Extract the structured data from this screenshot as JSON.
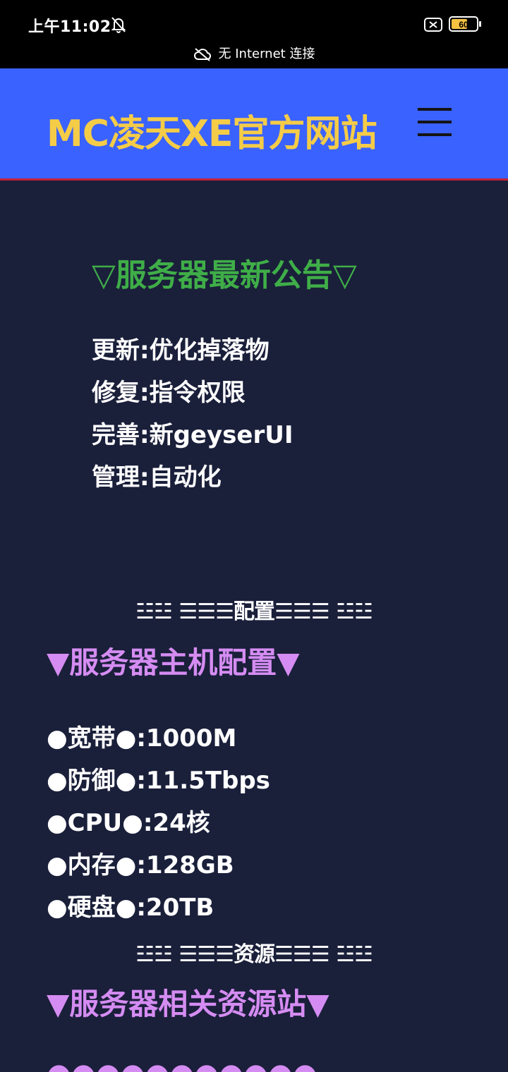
{
  "status_bar": {
    "time": "上午11:02",
    "network_text": "无 Internet 连接",
    "battery_level": "60"
  },
  "header": {
    "site_title": "MC凌天XE官方网站"
  },
  "notice": {
    "title": "▽服务器最新公告▽",
    "items": [
      "更新:优化掉落物",
      "修复:指令权限",
      "完善:新geyserUI",
      "管理:自动化"
    ]
  },
  "config": {
    "divider": "☳☳ ☰☰☰配置☰☰☰ ☳☳",
    "title": "▼服务器主机配置▼",
    "specs": [
      "●宽带●:1000M",
      "●防御●:11.5Tbps",
      "●CPU●:24核",
      "●内存●:128GB",
      "●硬盘●:20TB"
    ]
  },
  "resources": {
    "divider": "☳☳ ☰☰☰资源☰☰☰ ☳☳",
    "title": "▼服务器相关资源站▼",
    "next_item_partial": "●●●●●●●●●●●"
  },
  "colors": {
    "header_bg": "#3a62ff",
    "title_yellow": "#f5cc47",
    "notice_green": "#3fae48",
    "section_purple": "#d58cf2",
    "page_bg": "#1a1f3a"
  }
}
